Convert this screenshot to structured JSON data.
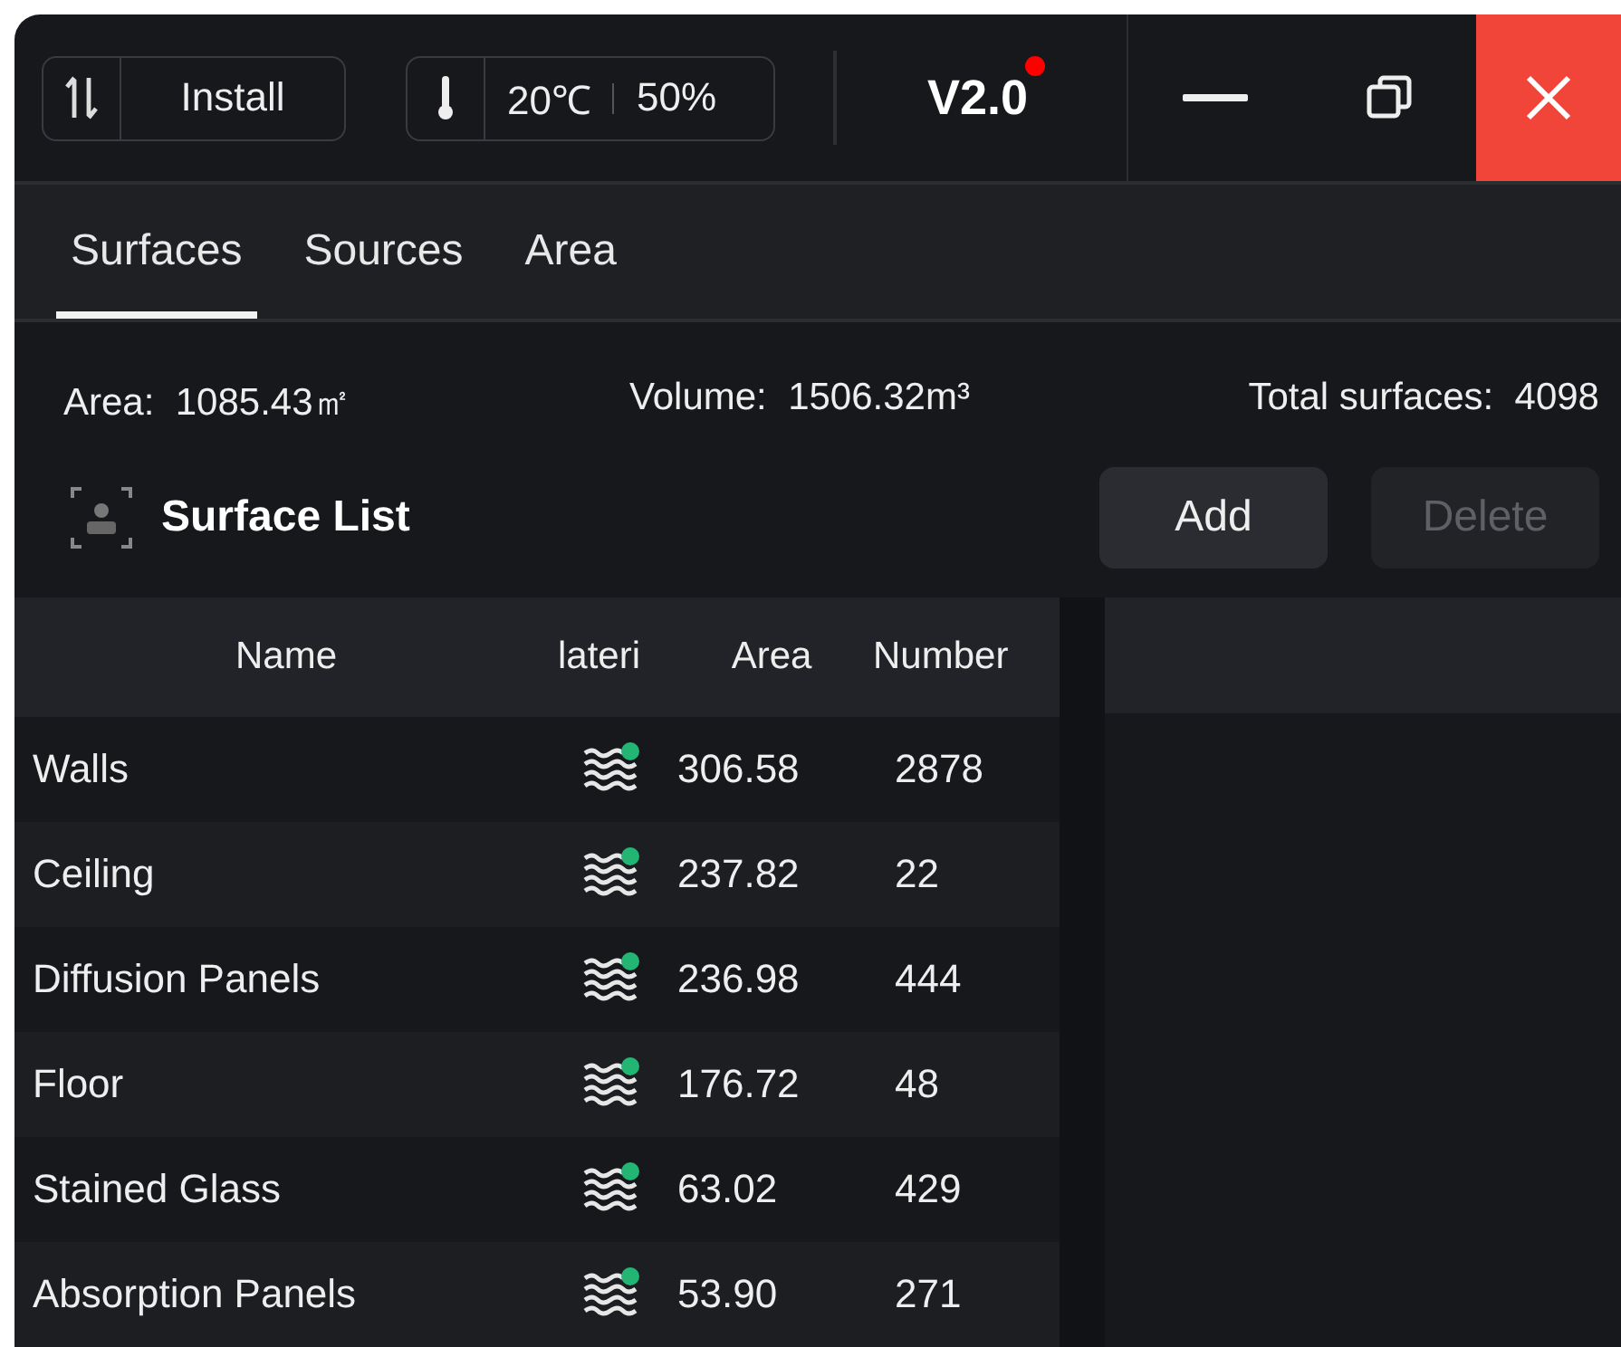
{
  "toolbar": {
    "install_button": "Install",
    "temperature": "20℃",
    "humidity": "50%",
    "version": "V2.0",
    "update_badge": true
  },
  "window_controls": [
    {
      "kind": "minimize"
    },
    {
      "kind": "restore"
    },
    {
      "kind": "close"
    }
  ],
  "tabs": [
    {
      "label": "Surfaces",
      "selected": true
    },
    {
      "label": "Sources",
      "selected": false
    },
    {
      "label": "Area",
      "selected": false
    }
  ],
  "stats": [
    {
      "label": "Area:",
      "value": "1085.43㎡"
    },
    {
      "label": "Volume:",
      "value": "1506.32m³"
    },
    {
      "label": "Total surfaces:",
      "value": "4098"
    }
  ],
  "section": {
    "title": "Surface List",
    "buttons": [
      {
        "label": "Add",
        "disabled": false
      },
      {
        "label": "Delete",
        "disabled": true
      }
    ]
  },
  "table": {
    "columns": [
      "Name",
      "lateri",
      "Area",
      "Number"
    ],
    "rows": [
      {
        "name": "Walls",
        "material_assigned": true,
        "area": "306.58",
        "number": "2878"
      },
      {
        "name": "Ceiling",
        "material_assigned": true,
        "area": "237.82",
        "number": "22"
      },
      {
        "name": "Diffusion Panels",
        "material_assigned": true,
        "area": "236.98",
        "number": "444"
      },
      {
        "name": "Floor",
        "material_assigned": true,
        "area": "176.72",
        "number": "48"
      },
      {
        "name": "Stained Glass",
        "material_assigned": true,
        "area": "63.02",
        "number": "429"
      },
      {
        "name": "Absorption Panels",
        "material_assigned": true,
        "area": "53.90",
        "number": "271"
      }
    ]
  }
}
